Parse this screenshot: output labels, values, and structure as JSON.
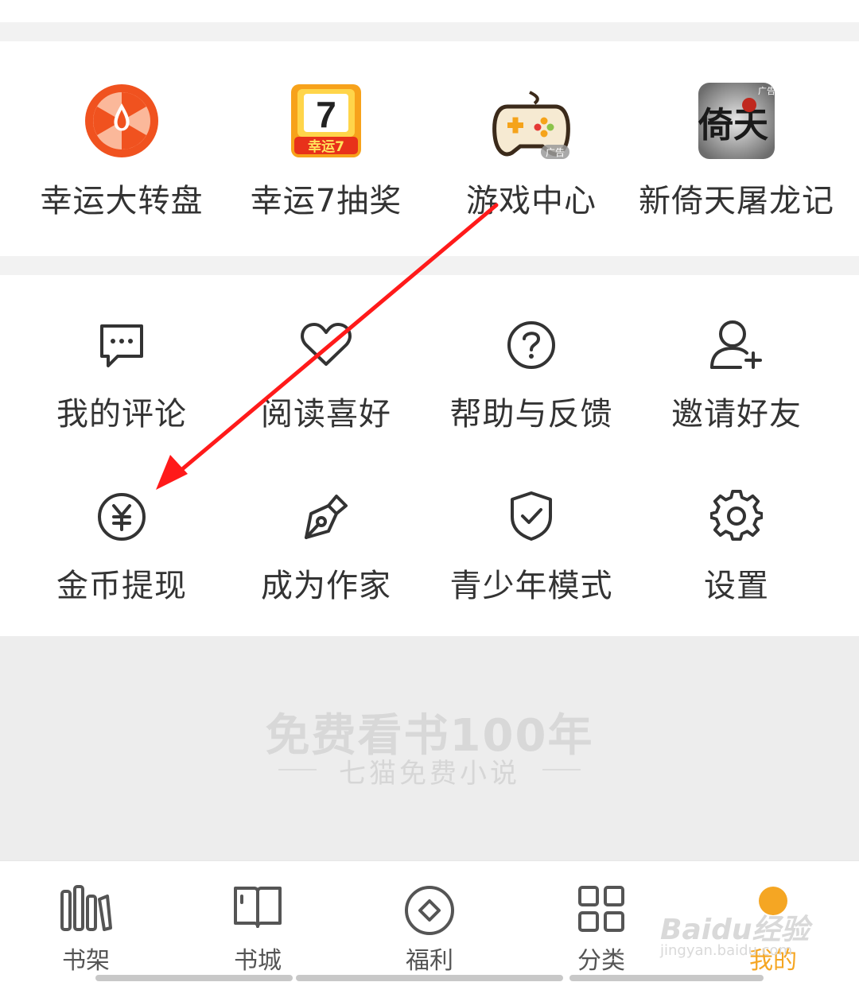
{
  "quick_actions": [
    {
      "label": "幸运大转盘",
      "icon": "lucky-wheel-icon"
    },
    {
      "label": "幸运7抽奖",
      "icon": "lucky-7-icon",
      "icon_text": "幸运7"
    },
    {
      "label": "游戏中心",
      "icon": "gamepad-icon",
      "badge": "广告"
    },
    {
      "label": "新倚天屠龙记",
      "icon": "game-ad-icon",
      "badge": "广告",
      "icon_text": "倚天"
    }
  ],
  "menu_row1": [
    {
      "label": "我的评论",
      "icon": "comment-icon"
    },
    {
      "label": "阅读喜好",
      "icon": "heart-icon"
    },
    {
      "label": "帮助与反馈",
      "icon": "help-icon"
    },
    {
      "label": "邀请好友",
      "icon": "add-user-icon"
    }
  ],
  "menu_row2": [
    {
      "label": "金币提现",
      "icon": "yuan-coin-icon"
    },
    {
      "label": "成为作家",
      "icon": "pen-icon"
    },
    {
      "label": "青少年模式",
      "icon": "shield-check-icon"
    },
    {
      "label": "设置",
      "icon": "gear-icon"
    }
  ],
  "slogan": {
    "main": "免费看书100年",
    "sub": "七猫免费小说"
  },
  "tabbar": [
    {
      "label": "书架",
      "icon": "bookshelf-icon"
    },
    {
      "label": "书城",
      "icon": "book-open-icon"
    },
    {
      "label": "福利",
      "icon": "diamond-icon"
    },
    {
      "label": "分类",
      "icon": "grid-icon"
    },
    {
      "label": "我的",
      "icon": "profile-dot-icon",
      "active": true
    }
  ],
  "watermark": {
    "main": "Baidu经验",
    "sub": "jingyan.baidu.com"
  },
  "colors": {
    "accent": "#f5a623",
    "annotation": "#ff1a1a",
    "icon": "#333333"
  }
}
